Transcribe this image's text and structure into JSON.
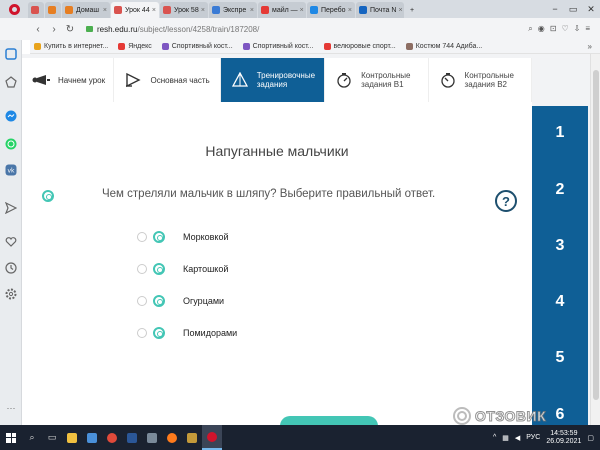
{
  "browser": {
    "tabs": [
      {
        "label": "",
        "color": "#d9534f",
        "active": false,
        "small": true
      },
      {
        "label": "",
        "color": "#e67e22",
        "active": false,
        "small": true
      },
      {
        "label": "Домаш",
        "color": "#e67e22",
        "active": false,
        "small": false
      },
      {
        "label": "Урок 44",
        "color": "#d9534f",
        "active": true,
        "small": false
      },
      {
        "label": "Урок 58",
        "color": "#d9534f",
        "active": false,
        "small": false
      },
      {
        "label": "Экспре",
        "color": "#3a7bd5",
        "active": false,
        "small": false
      },
      {
        "label": "майл —",
        "color": "#e53935",
        "active": false,
        "small": false
      },
      {
        "label": "Перебо",
        "color": "#1e88e5",
        "active": false,
        "small": false
      },
      {
        "label": "Почта N",
        "color": "#1565c0",
        "active": false,
        "small": false
      }
    ],
    "new_tab": "+",
    "window_controls": {
      "min": "−",
      "max": "▭",
      "close": "✕"
    },
    "url_host": "resh.edu.ru",
    "url_path": "/subject/lesson/4258/train/187208/",
    "address_icons": [
      "⌕",
      "◉",
      "⊡",
      "♡",
      "⇩",
      "≡"
    ],
    "bookmarks": [
      {
        "label": "Купить в интернет...",
        "color": "#e8a31c"
      },
      {
        "label": "Яндекс",
        "color": "#e53935"
      },
      {
        "label": "Спортивный кост...",
        "color": "#7e57c2"
      },
      {
        "label": "Спортивный кост...",
        "color": "#7e57c2"
      },
      {
        "label": "велюровые спорт...",
        "color": "#e53935"
      },
      {
        "label": "Костюм 744 Адиба...",
        "color": "#8d6e63"
      }
    ],
    "bookmarks_more": "»"
  },
  "sidebar": {
    "icons": [
      "home-icon",
      "bookmark-icon",
      "messenger-icon",
      "whatsapp-icon",
      "vk-icon",
      "send-icon",
      "heart-icon",
      "history-icon",
      "settings-icon",
      "more-icon"
    ]
  },
  "lesson_nav": {
    "items": [
      {
        "label": "Начнем урок"
      },
      {
        "label": "Основная часть"
      },
      {
        "label": "Тренировочные задания"
      },
      {
        "label": "Контрольные задания В1"
      },
      {
        "label": "Контрольные задания В2"
      }
    ]
  },
  "task": {
    "title": "Напуганные мальчики",
    "question": "Чем стреляли мальчик в шляпу? Выберите правильный ответ.",
    "help": "?",
    "options": [
      "Морковкой",
      "Картошкой",
      "Огурцами",
      "Помидорами"
    ]
  },
  "task_numbers": [
    "1",
    "2",
    "3",
    "4",
    "5",
    "6"
  ],
  "watermark": "ОТЗОВИК",
  "taskbar": {
    "lang": "РУС",
    "time": "14:53:59",
    "date": "26.09.2021",
    "tray_chevron": "^"
  },
  "colors": {
    "accent_blue": "#0f5f96",
    "teal": "#43c6b5",
    "opera_red": "#d0142c",
    "taskbar": "#1a2230"
  }
}
